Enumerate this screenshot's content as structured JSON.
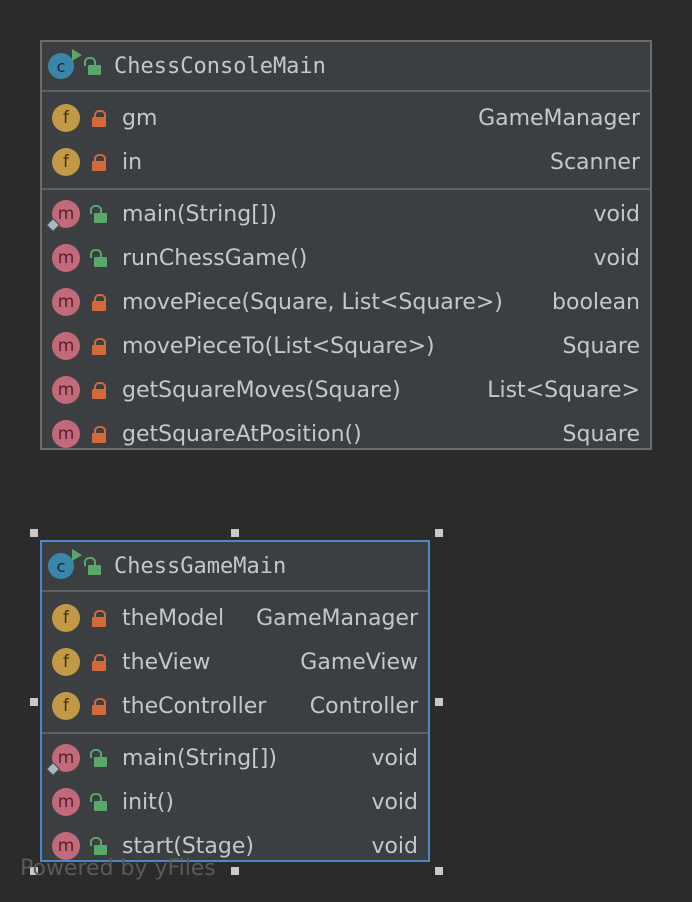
{
  "classes": [
    {
      "name": "ChessConsoleMain",
      "fields": [
        {
          "name": "gm",
          "type": "GameManager"
        },
        {
          "name": "in",
          "type": "Scanner"
        }
      ],
      "methods": [
        {
          "name": "main(String[])",
          "type": "void"
        },
        {
          "name": "runChessGame()",
          "type": "void"
        },
        {
          "name": "movePiece(Square, List<Square>)",
          "type": "boolean"
        },
        {
          "name": "movePieceTo(List<Square>)",
          "type": "Square"
        },
        {
          "name": "getSquareMoves(Square)",
          "type": "List<Square>"
        },
        {
          "name": "getSquareAtPosition()",
          "type": "Square"
        }
      ]
    },
    {
      "name": "ChessGameMain",
      "fields": [
        {
          "name": "theModel",
          "type": "GameManager"
        },
        {
          "name": "theView",
          "type": "GameView"
        },
        {
          "name": "theController",
          "type": "Controller"
        }
      ],
      "methods": [
        {
          "name": "main(String[])",
          "type": "void"
        },
        {
          "name": "init()",
          "type": "void"
        },
        {
          "name": "start(Stage)",
          "type": "void"
        }
      ]
    }
  ],
  "icons": {
    "class": "c",
    "field": "f",
    "method": "m"
  },
  "watermark": "Powered by yFiles",
  "colors": {
    "background": "#2b2b2b",
    "node": "#3c3f41",
    "selection": "#4a88c7"
  }
}
